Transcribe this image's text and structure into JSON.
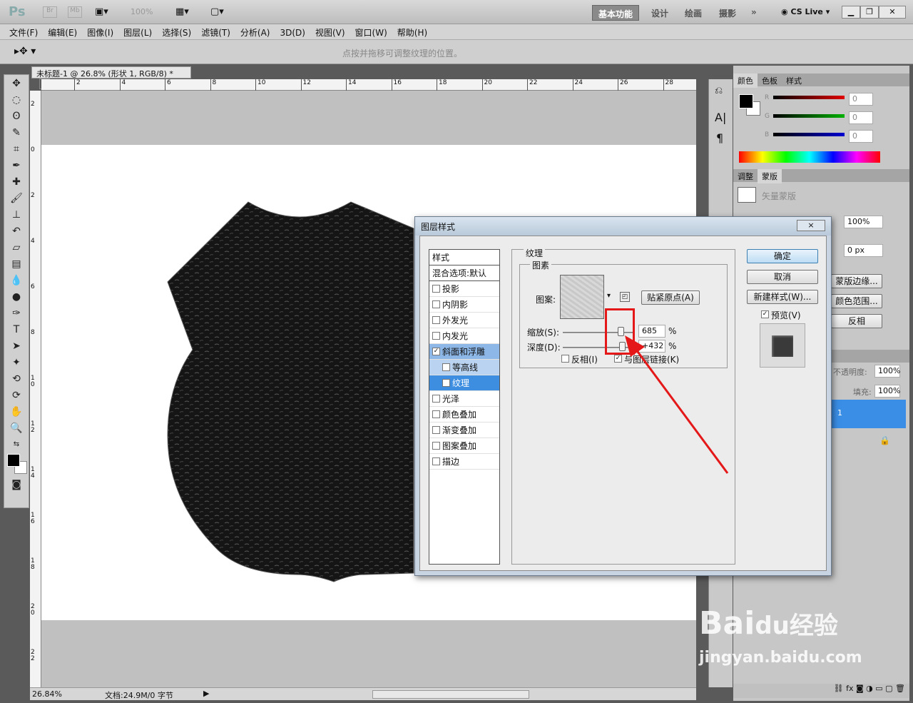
{
  "app": {
    "logo": "Ps",
    "badge_br": "Br",
    "badge_mb": "Mb",
    "zoom": "100%",
    "workspaces": [
      "基本功能",
      "设计",
      "绘画",
      "摄影"
    ],
    "more": "»",
    "cslive": "CS Live"
  },
  "menu": [
    "文件(F)",
    "编辑(E)",
    "图像(I)",
    "图层(L)",
    "选择(S)",
    "滤镜(T)",
    "分析(A)",
    "3D(D)",
    "视图(V)",
    "窗口(W)",
    "帮助(H)"
  ],
  "options": {
    "hint": "点按并拖移可调整纹理的位置。"
  },
  "doc": {
    "tab": "未标题-1 @ 26.8% (形状 1, RGB/8) *",
    "close": "×"
  },
  "ruler": {
    "top": [
      "2",
      "4",
      "6",
      "8",
      "10",
      "12",
      "14",
      "16",
      "18",
      "20",
      "22",
      "24",
      "26",
      "28"
    ],
    "left": [
      "2",
      "0",
      "2",
      "4",
      "6",
      "8",
      "1 0",
      "1 2",
      "1 4",
      "1 6",
      "1 8",
      "2 0",
      "2 2"
    ]
  },
  "status": {
    "zoom": "26.84%",
    "doc": "文档:24.9M/0 字节"
  },
  "panel": {
    "tabs1": [
      "颜色",
      "色板",
      "样式"
    ],
    "rgb": [
      {
        "label": "R",
        "value": "0",
        "color": "#e00000"
      },
      {
        "label": "G",
        "value": "0",
        "color": "#00b000"
      },
      {
        "label": "B",
        "value": "0",
        "color": "#0000d0"
      }
    ],
    "tabs2": [
      "调整",
      "蒙版"
    ],
    "mask_label": "矢量蒙版",
    "density": "100%",
    "feather": "0 px",
    "mask_btns": [
      "蒙版边缘...",
      "颜色范围...",
      "反相"
    ],
    "layers": {
      "opacity_label": "不透明度:",
      "opacity": "100%",
      "fill_label": "填充:",
      "fill": "100%",
      "layer_name": "1"
    }
  },
  "dialog": {
    "title": "图层样式",
    "close": "×",
    "styles_header": "样式",
    "blend": "混合选项:默认",
    "items": [
      {
        "label": "投影",
        "checked": false
      },
      {
        "label": "内阴影",
        "checked": false
      },
      {
        "label": "外发光",
        "checked": false
      },
      {
        "label": "内发光",
        "checked": false
      },
      {
        "label": "斜面和浮雕",
        "checked": true
      },
      {
        "label": "等高线",
        "checked": false
      },
      {
        "label": "纹理",
        "checked": true
      },
      {
        "label": "光泽",
        "checked": false
      },
      {
        "label": "颜色叠加",
        "checked": false
      },
      {
        "label": "渐变叠加",
        "checked": false
      },
      {
        "label": "图案叠加",
        "checked": false
      },
      {
        "label": "描边",
        "checked": false
      }
    ],
    "section": "纹理",
    "subsection": "图素",
    "pattern_label": "图案:",
    "snap_btn": "贴紧原点(A)",
    "scale_label": "缩放(S):",
    "scale": "685",
    "depth_label": "深度(D):",
    "depth": "+432",
    "pct": "%",
    "invert_label": "反相(I)",
    "link_label": "与图层链接(K)",
    "ok": "确定",
    "cancel": "取消",
    "new_style": "新建样式(W)...",
    "preview": "预览(V)"
  },
  "watermark": {
    "brand": "Bai",
    "brand2": "du",
    "brand3": "经验",
    "url": "jingyan.baidu.com"
  }
}
